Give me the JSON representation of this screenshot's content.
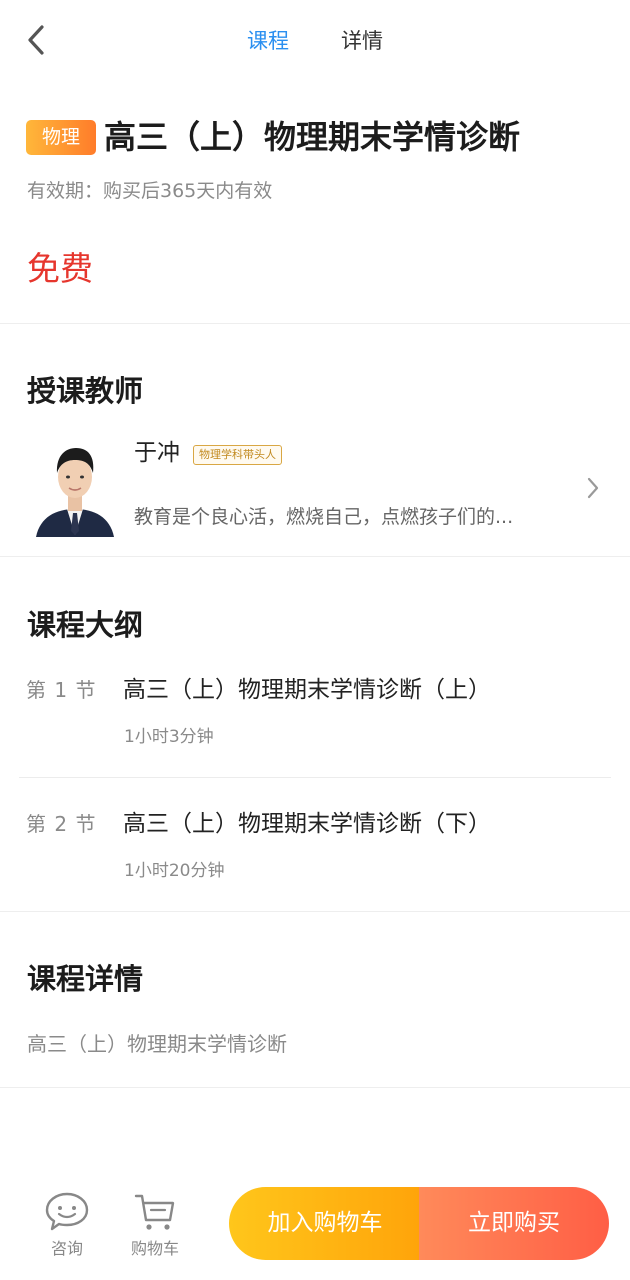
{
  "header": {
    "back_icon": "chevron-left-icon",
    "tabs": [
      {
        "label": "课程",
        "active": true
      },
      {
        "label": "详情",
        "active": false
      }
    ],
    "active_color": "#2a8ff0"
  },
  "course": {
    "subject_tag": "物理",
    "title": "高三（上）物理期末学情诊断",
    "validity": "有效期：购买后365天内有效",
    "price": "免费",
    "price_color": "#e6362d"
  },
  "teacher_section": {
    "heading": "授课教师",
    "teacher": {
      "name": "于冲",
      "badge": "物理学科带头人",
      "motto": "教育是个良心活，燃烧自己，点燃孩子们的...",
      "chevron_icon": "chevron-right-icon"
    }
  },
  "outline": {
    "heading": "课程大纲",
    "lessons": [
      {
        "number": "第 1 节",
        "title": "高三（上）物理期末学情诊断（上）",
        "duration": "1小时3分钟"
      },
      {
        "number": "第 2 节",
        "title": "高三（上）物理期末学情诊断（下）",
        "duration": "1小时20分钟"
      }
    ]
  },
  "details": {
    "heading": "课程详情",
    "text": "高三（上）物理期末学情诊断"
  },
  "bottom_bar": {
    "consult_label": "咨询",
    "consult_icon": "chat-bubble-icon",
    "cart_label": "购物车",
    "cart_icon": "shopping-cart-icon",
    "add_to_cart_label": "加入购物车",
    "buy_now_label": "立即购买"
  }
}
